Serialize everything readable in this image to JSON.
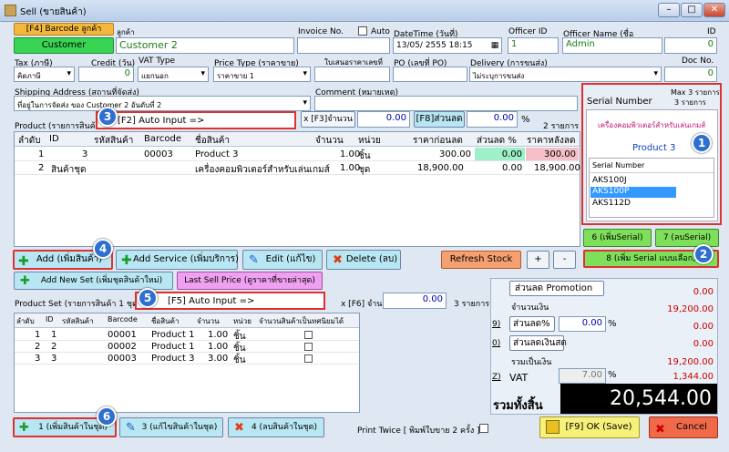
{
  "window": {
    "title": "Sell (ขายสินค้า)"
  },
  "top": {
    "barcode_btn": "[F4] Barcode ลูกค้า",
    "customer_btn": "Customer",
    "customer_label": "ลูกค้า",
    "customer_value": "Customer 2",
    "invoice_label": "Invoice No.",
    "auto_label": "Auto",
    "datetime_label": "DateTime (วันที่)",
    "datetime_value": "13/05/ 2555 18:15",
    "officer_id_label": "Officer ID",
    "officer_id_value": "1",
    "officer_name_label": "Officer Name (ชื่อ",
    "officer_name_value": "Admin",
    "id_label": "ID",
    "id_value": "0"
  },
  "row2": {
    "tax_label": "Tax (ภาษี)",
    "tax_value": "คิดภาษี",
    "credit_label": "Credit (วัน)",
    "credit_value": "0",
    "vat_type_label": "VAT Type",
    "vat_type_value": "แยกนอก",
    "price_type_label": "Price Type (ราคาขาย)",
    "price_type_value": "ราคาขาย 1",
    "quote_label": "ใบเสนอราคาเลขที่",
    "po_label": "PO (เลขที่ PO)",
    "delivery_label": "Delivery (การขนส่ง)",
    "delivery_value": "ไม่ระบุการขนส่ง",
    "doc_label": "Doc No.",
    "doc_value": "0"
  },
  "row3": {
    "shipping_label": "Shipping Address (สถานที่จัดส่ง)",
    "shipping_value": "ที่อยู่ในการจัดส่ง ของ Customer 2 อันดับที่ 2",
    "comment_label": "Comment (หมายเหตุ)"
  },
  "product": {
    "label": "Product (รายการสินค้า)",
    "auto_input": "[F2] Auto Input =>",
    "qty_label": "x [F3]จำนวน",
    "qty_value": "0.00",
    "discount_btn": "[F8]ส่วนลด",
    "discount_value": "0.00",
    "pct": "%",
    "count": "2 รายการ",
    "columns": [
      "ลำดับ",
      "ID",
      "รหัสสินค้า",
      "Barcode",
      "ชื่อสินค้า",
      "จำนวน",
      "หน่วย",
      "ราคาก่อนลด",
      "ส่วนลด %",
      "ราคาหลังลด"
    ],
    "rows": [
      [
        "1",
        "3",
        "",
        "00003",
        "Product 3",
        "1.00",
        "ชิ้น",
        "300.00",
        "0.00",
        "300.00"
      ],
      [
        "2",
        "สินค้าชุด",
        "",
        "",
        "เครื่องคอมพิวเตอร์สำหรับเล่นเกมส์",
        "1.00",
        "ชุด",
        "18,900.00",
        "0.00",
        "18,900.00"
      ]
    ]
  },
  "serial": {
    "max": "Max 3 รายการ",
    "count": "3 รายการ",
    "title": "Serial Number",
    "set_name": "เครื่องคอมพิวเตอร์สำหรับเล่นเกมส์",
    "product": "Product 3",
    "col": "Serial Number",
    "items": [
      "AKS100J",
      "AKS100P",
      "AKS112D"
    ],
    "add_btn": "6 (เพิ่มSerial)",
    "del_btn": "7 (ลบSerial)",
    "multi_btn": "8 (เพิ่ม Serial แบบเลือก)"
  },
  "actions": {
    "add": "Add (เพิ่มสินค้า)",
    "add_service": "Add Service (เพิ่มบริการ)",
    "edit": "Edit (แก้ไข)",
    "delete": "Delete (ลบ)",
    "refresh": "Refresh Stock",
    "plus": "+",
    "minus": "-",
    "add_set": "Add New Set (เพิ่มชุดสินค้าใหม่)",
    "last_price": "Last Sell Price (ดูราคาที่ขายล่าสุด)"
  },
  "set": {
    "label": "Product Set (รายการสินค้า 1 ชุด)",
    "auto_input": "[F5] Auto Input =>",
    "qty_label": "x [F6] จำนวน",
    "qty_value": "0.00",
    "count": "3 รายการ",
    "columns": [
      "ลำดับ",
      "ID",
      "รหัสสินค้า",
      "Barcode",
      "ชื่อสินค้า",
      "จำนวน",
      "หน่วย",
      "จำนวนสินค้าเป็นทศนิยมได้"
    ],
    "rows": [
      [
        "1",
        "1",
        "",
        "00001",
        "Product 1",
        "1.00",
        "ชิ้น"
      ],
      [
        "2",
        "2",
        "",
        "00002",
        "Product 1",
        "1.00",
        "ชิ้น"
      ],
      [
        "3",
        "3",
        "",
        "00003",
        "Product 3",
        "3.00",
        "ชิ้น"
      ]
    ]
  },
  "totals": {
    "promotion_btn": "ส่วนลด Promotion",
    "promotion_value": "0.00",
    "amount_label": "จำนวนเงิน",
    "amount_value": "19,200.00",
    "disc_pct_btn": "ส่วนลด%",
    "disc_pct_value": "0.00",
    "pct": "%",
    "disc_pct_amount": "0.00",
    "disc_cash_btn": "ส่วนลดเงินสด",
    "disc_cash_value": "0.00",
    "total_label": "รวมเป็นเงิน",
    "total_value": "19,200.00",
    "vat_label": "VAT",
    "vat_rate": "7.00",
    "vat_value": "1,344.00",
    "grand_label": "รวมทั้งสิ้น",
    "grand_value": "20,544.00",
    "shortcut_9": "9)",
    "shortcut_0": "0)",
    "shortcut_z": "Z)"
  },
  "bottom": {
    "add_set_item": "1 (เพิ่มสินค้าในชุด)",
    "edit_set_item": "3 (แก้ไขสินค้าในชุด)",
    "delete_set_item": "4 (ลบสินค้าในชุด)",
    "print_twice": "Print Twice [ พิมพ์ใบขาย 2 ครั้ง ]",
    "ok": "[F9] OK (Save)",
    "cancel": "Cancel"
  },
  "callouts": [
    "1",
    "2",
    "3",
    "4",
    "5",
    "6"
  ]
}
